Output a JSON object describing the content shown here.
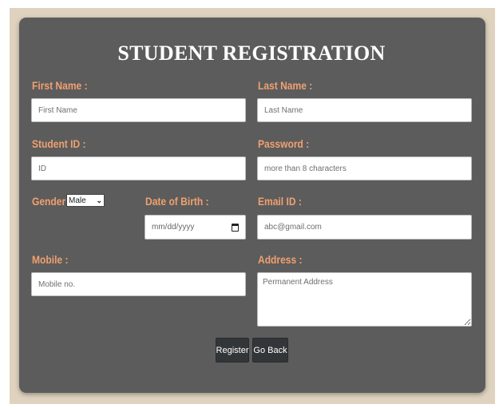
{
  "form": {
    "title": "STUDENT REGISTRATION",
    "first_name": {
      "label": "First Name :",
      "placeholder": "First Name"
    },
    "last_name": {
      "label": "Last Name :",
      "placeholder": "Last Name"
    },
    "student_id": {
      "label": "Student ID :",
      "placeholder": "ID"
    },
    "password": {
      "label": "Password :",
      "placeholder": "more than 8 characters"
    },
    "gender": {
      "label": "Gender :",
      "selected": "Male"
    },
    "dob": {
      "label": "Date of Birth :",
      "placeholder": "mm/dd/yyyy"
    },
    "email": {
      "label": "Email ID :",
      "placeholder": "abc@gmail.com"
    },
    "mobile": {
      "label": "Mobile :",
      "placeholder": "Mobile no."
    },
    "address": {
      "label": "Address :",
      "placeholder": "Permanent Address"
    },
    "register_label": "Register",
    "go_back_label": "Go Back"
  },
  "colors": {
    "page_border": "#dfd3bf",
    "card_bg": "#5c5c5c",
    "label_color": "#f0a070",
    "button_bg": "#333638"
  }
}
